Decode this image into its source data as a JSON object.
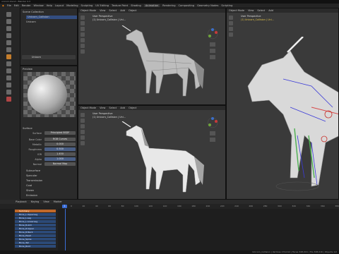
{
  "title": "unicorn.blend - Blender 4.3",
  "menu": [
    "File",
    "Edit",
    "Render",
    "Window",
    "Help",
    "Layout",
    "Modeling",
    "Sculpting",
    "UV Editing",
    "Texture Paint",
    "Shading",
    "Animation",
    "Rendering",
    "Compositing",
    "Geometry Nodes",
    "Scripting"
  ],
  "outliner": {
    "items": [
      "Scene Collection",
      "Unicorn_Collision",
      "Unicorn"
    ],
    "selected_object": "Unicorn"
  },
  "preview_label": "Preview",
  "surface": {
    "label": "Surface",
    "surface_value": "Principled BSDF",
    "fields": [
      {
        "label": "Base Color",
        "value": "RGB Curves"
      },
      {
        "label": "Metallic",
        "value": "0.000"
      },
      {
        "label": "Roughness",
        "value": "0.500"
      },
      {
        "label": "IOR",
        "value": "1.450"
      },
      {
        "label": "Alpha",
        "value": "1.000"
      },
      {
        "label": "Normal",
        "value": "Normal Map"
      }
    ],
    "sections": [
      "Subsurface",
      "Specular",
      "Transmission",
      "Coat",
      "Sheen",
      "Emission"
    ]
  },
  "viewport_header": [
    "Object Mode",
    "View",
    "Select",
    "Add",
    "Object"
  ],
  "viewport_tl": {
    "info1": "User Perspective",
    "info2": "(1) Unicorn_Collision | Uni..."
  },
  "viewport_bl": {
    "info1": "User Perspective",
    "info2": "(1) Unicorn_Collision | Uni..."
  },
  "viewport_r": {
    "info1": "User Perspective",
    "info2": "(1) Unicorn_Collision | Uni..."
  },
  "timeline": {
    "menus": [
      "Playback",
      "Keying",
      "View",
      "Marker"
    ],
    "current_frame": "1",
    "ticks": [
      "0",
      "20",
      "40",
      "60",
      "80",
      "100",
      "120",
      "140",
      "160",
      "180",
      "200",
      "220",
      "240",
      "260",
      "280",
      "300",
      "320",
      "340",
      "360",
      "380"
    ],
    "channels": [
      "Summary",
      "Bone_L.UpperLeg",
      "Bone_L.Leg",
      "Bone_L.LowerLeg",
      "Bone_R.Arm",
      "Bone_R.Upper",
      "Bone_R.Neck",
      "Bone_Head",
      "Bone_Spine",
      "Bone_Tail",
      "Bone_Root"
    ]
  },
  "status": "Unicorn_Collision | Vertices 174,012 | Faces 348,016 | Tris 348,016 | Objects 1/2"
}
